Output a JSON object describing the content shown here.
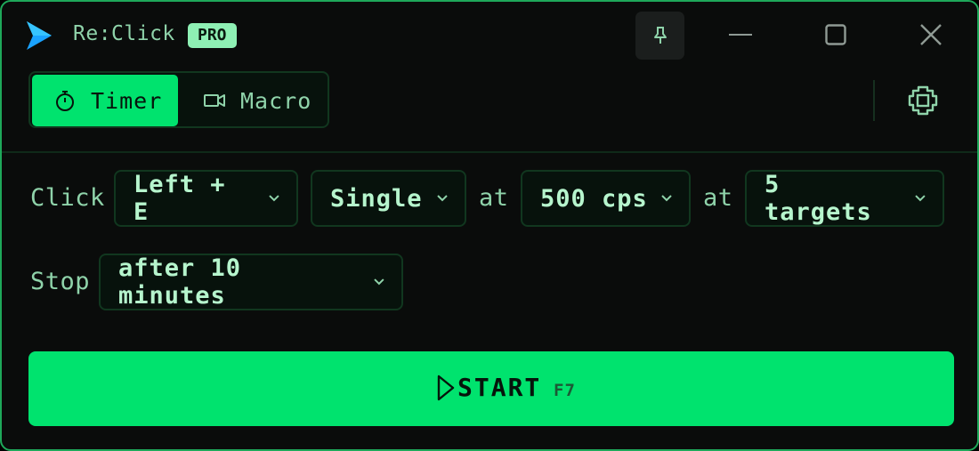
{
  "app": {
    "title": "Re:Click",
    "badge": "PRO"
  },
  "mode_tabs": [
    {
      "label": "Timer",
      "icon": "stopwatch-icon",
      "active": true
    },
    {
      "label": "Macro",
      "icon": "video-camera-icon",
      "active": false
    }
  ],
  "click_row": {
    "label": "Click",
    "button": "Left + E",
    "type": "Single",
    "at1": "at",
    "rate": "500 cps",
    "at2": "at",
    "targets": "5 targets"
  },
  "stop_row": {
    "label": "Stop",
    "condition": "after 10 minutes"
  },
  "start": {
    "label": "START",
    "hotkey": "F7"
  },
  "colors": {
    "accent": "#00e36e",
    "text": "#8fd3aa",
    "badge": "#8ef0b4",
    "window_border": "#1ea85a",
    "background": "#0a0c0b"
  }
}
